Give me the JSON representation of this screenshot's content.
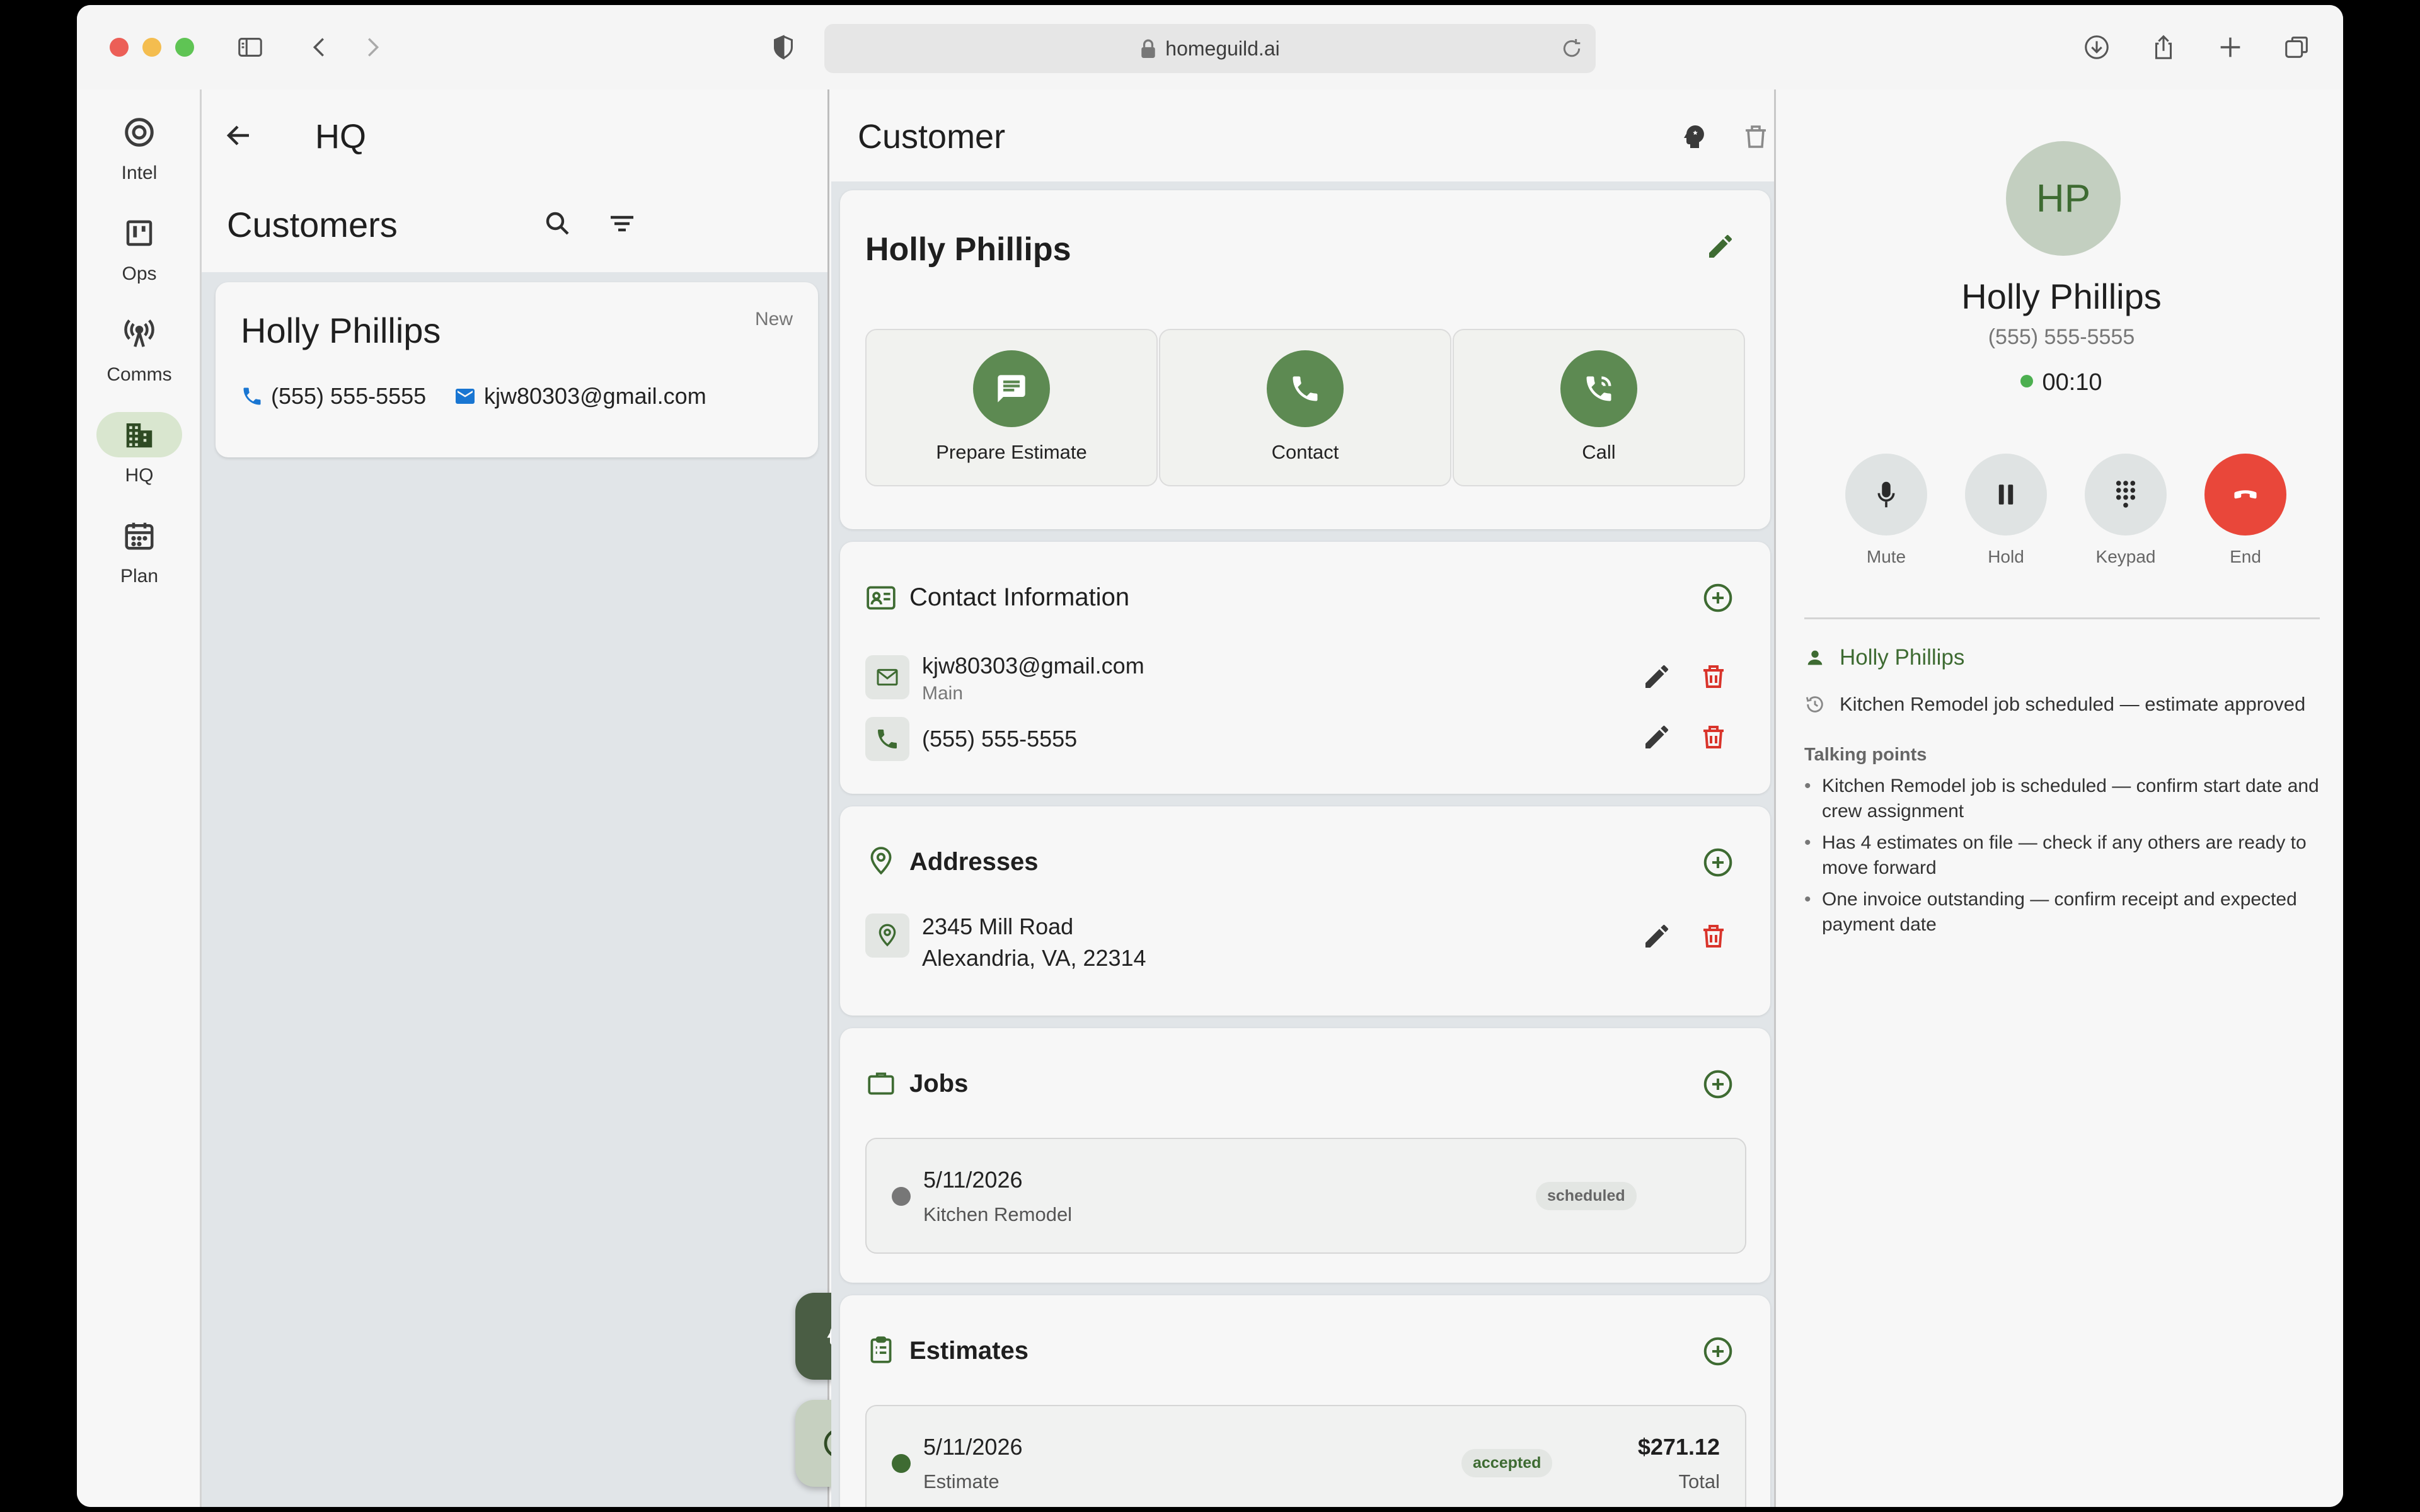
{
  "browser": {
    "url": "homeguild.ai",
    "traffic_colors": [
      "#ec5f57",
      "#f4bd4f",
      "#5fc454"
    ]
  },
  "rail": {
    "items": [
      {
        "label": "Intel",
        "icon": "at-target-icon",
        "active": false
      },
      {
        "label": "Ops",
        "icon": "kanban-icon",
        "active": false
      },
      {
        "label": "Comms",
        "icon": "broadcast-tower-icon",
        "active": false
      },
      {
        "label": "HQ",
        "icon": "building-icon",
        "active": true
      },
      {
        "label": "Plan",
        "icon": "calendar-icon",
        "active": false
      }
    ]
  },
  "list": {
    "title": "HQ",
    "section_title": "Customers",
    "customer": {
      "name": "Holly Phillips",
      "badge": "New",
      "phone": "(555) 555-5555",
      "email": "kjw80303@gmail.com"
    }
  },
  "detail": {
    "title": "Customer",
    "header": {
      "name": "Holly Phillips",
      "actions": [
        {
          "label": "Prepare Estimate",
          "icon": "chat-bubble-icon"
        },
        {
          "label": "Contact",
          "icon": "phone-icon"
        },
        {
          "label": "Call",
          "icon": "phone-call-icon"
        }
      ]
    },
    "contact": {
      "title": "Contact Information",
      "email": "kjw80303@gmail.com",
      "email_tag": "Main",
      "phone": "(555) 555-5555"
    },
    "addresses": {
      "title": "Addresses",
      "line1": "2345 Mill Road",
      "line2": "Alexandria, VA, 22314"
    },
    "jobs": {
      "title": "Jobs",
      "items": [
        {
          "date": "5/11/2026",
          "name": "Kitchen Remodel",
          "status": "scheduled",
          "dot_color": "#777777"
        }
      ]
    },
    "estimates": {
      "title": "Estimates",
      "items": [
        {
          "date": "5/11/2026",
          "name": "Estimate",
          "status": "accepted",
          "amount": "$271.12",
          "amount_label": "Total",
          "dot_color": "#3e6b32"
        }
      ]
    }
  },
  "call": {
    "initials": "HP",
    "name": "Holly Phillips",
    "number": "(555) 555-5555",
    "timer": "00:10",
    "controls": [
      {
        "label": "Mute",
        "icon": "microphone-icon"
      },
      {
        "label": "Hold",
        "icon": "pause-icon"
      },
      {
        "label": "Keypad",
        "icon": "keypad-icon"
      },
      {
        "label": "End",
        "icon": "hang-up-icon"
      }
    ],
    "customer_link": "Holly Phillips",
    "history": "Kitchen Remodel job scheduled — estimate approved",
    "talking_points_title": "Talking points",
    "talking_points": [
      "Kitchen Remodel job is scheduled — confirm start date and crew assignment",
      "Has 4 estimates on file — check if any others are ready to move forward",
      "One invoice outstanding — confirm receipt and expected payment date"
    ]
  }
}
